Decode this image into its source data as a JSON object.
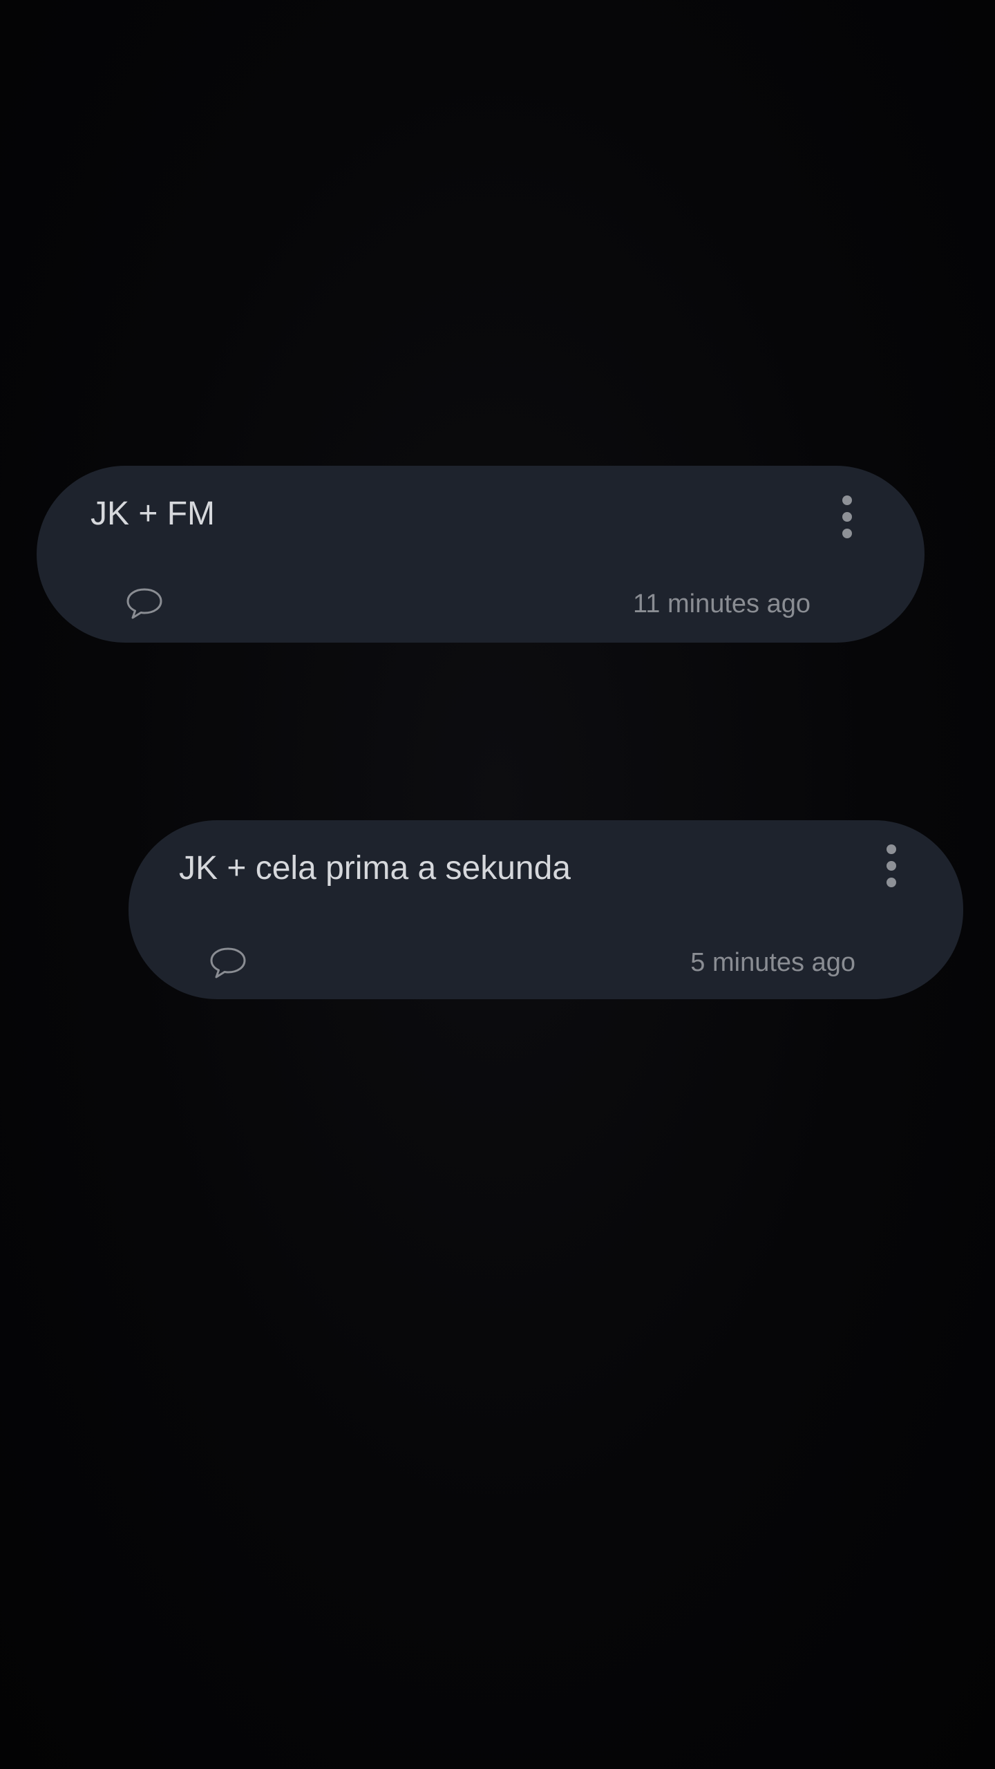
{
  "notes": [
    {
      "title": "JK + FM",
      "timestamp": "11 minutes ago",
      "comment_icon": "comment-icon",
      "menu_icon": "more-vert-icon"
    },
    {
      "title": "JK + cela prima a sekunda",
      "timestamp": "5 minutes ago",
      "comment_icon": "comment-icon",
      "menu_icon": "more-vert-icon"
    }
  ],
  "colors": {
    "background": "#050507",
    "card": "#1e232d",
    "title": "#d6d8dc",
    "secondary": "#8a8d93"
  }
}
